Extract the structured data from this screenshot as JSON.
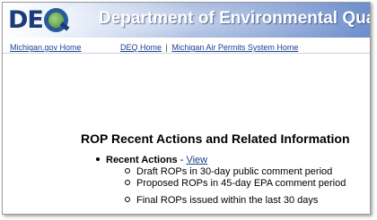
{
  "header": {
    "logo_left": "DE",
    "logo_right": "Q",
    "title": "Department of Environmental Quality"
  },
  "links": {
    "michigan_home": "Michigan.gov Home",
    "deq_home": "DEQ Home",
    "separator": "|",
    "air_permits_home": "Michigan Air Permits System Home"
  },
  "main": {
    "heading": "ROP Recent Actions and Related Information",
    "recent_actions": {
      "label": "Recent Actions",
      "dash": " - ",
      "view_link": "View",
      "items": [
        "Draft ROPs in 30-day public comment period",
        "Proposed ROPs in 45-day EPA comment period",
        "Final ROPs issued within the last 30 days"
      ]
    }
  },
  "colors": {
    "link": "#1d3f8f",
    "banner_dark": "#6f8fcc",
    "logo_blue": "#1b3c7a"
  }
}
